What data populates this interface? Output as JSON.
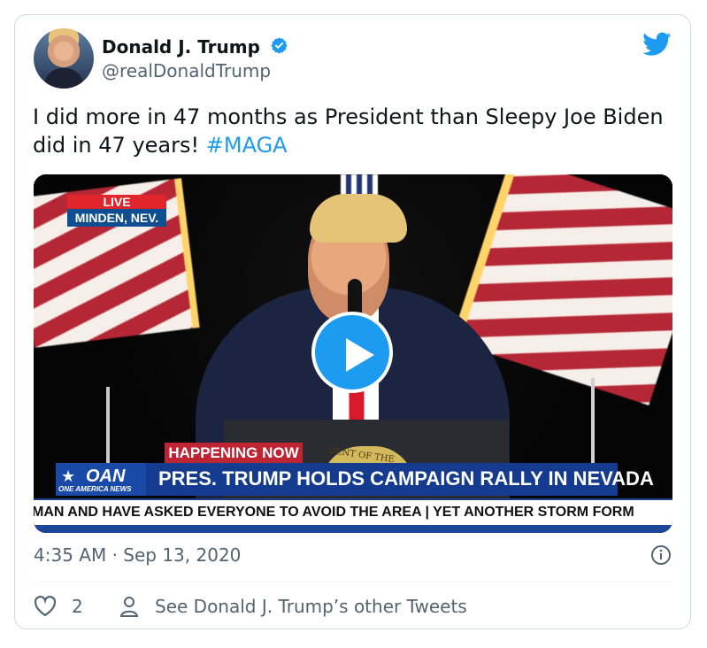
{
  "tweet": {
    "author_name": "Donald J. Trump",
    "author_handle": "@realDonaldTrump",
    "text_prefix": "I did more in 47 months as President than Sleepy Joe Biden did in 47 years! ",
    "hashtag": "#MAGA",
    "timestamp": "4:35 AM · Sep 13, 2020",
    "likes": "2",
    "other_tweets": "See Donald J. Trump’s other Tweets"
  },
  "media": {
    "live_label": "LIVE",
    "location_label": "MINDEN, NEV.",
    "happening_now": "HAPPENING NOW",
    "network_logo": "OAN",
    "network_subtitle": "ONE AMERICA NEWS",
    "headline": "PRES. TRUMP HOLDS CAMPAIGN RALLY IN NEVADA",
    "ticker": "MAN AND HAVE ASKED EVERYONE TO AVOID THE AREA  |  YET ANOTHER STORM FORM",
    "podium_seal_text": "DENT OF THE"
  },
  "icons": {
    "verified": "verified-badge-icon",
    "twitter": "twitter-bird-icon",
    "play": "play-button-icon",
    "info": "info-icon",
    "heart": "heart-icon",
    "person": "person-icon"
  },
  "colors": {
    "accent": "#1d9bf0",
    "text": "#0f1419",
    "muted": "#536471",
    "border": "#cfd9de",
    "oan_blue": "#143b8d",
    "happening_red": "#bf2434"
  }
}
